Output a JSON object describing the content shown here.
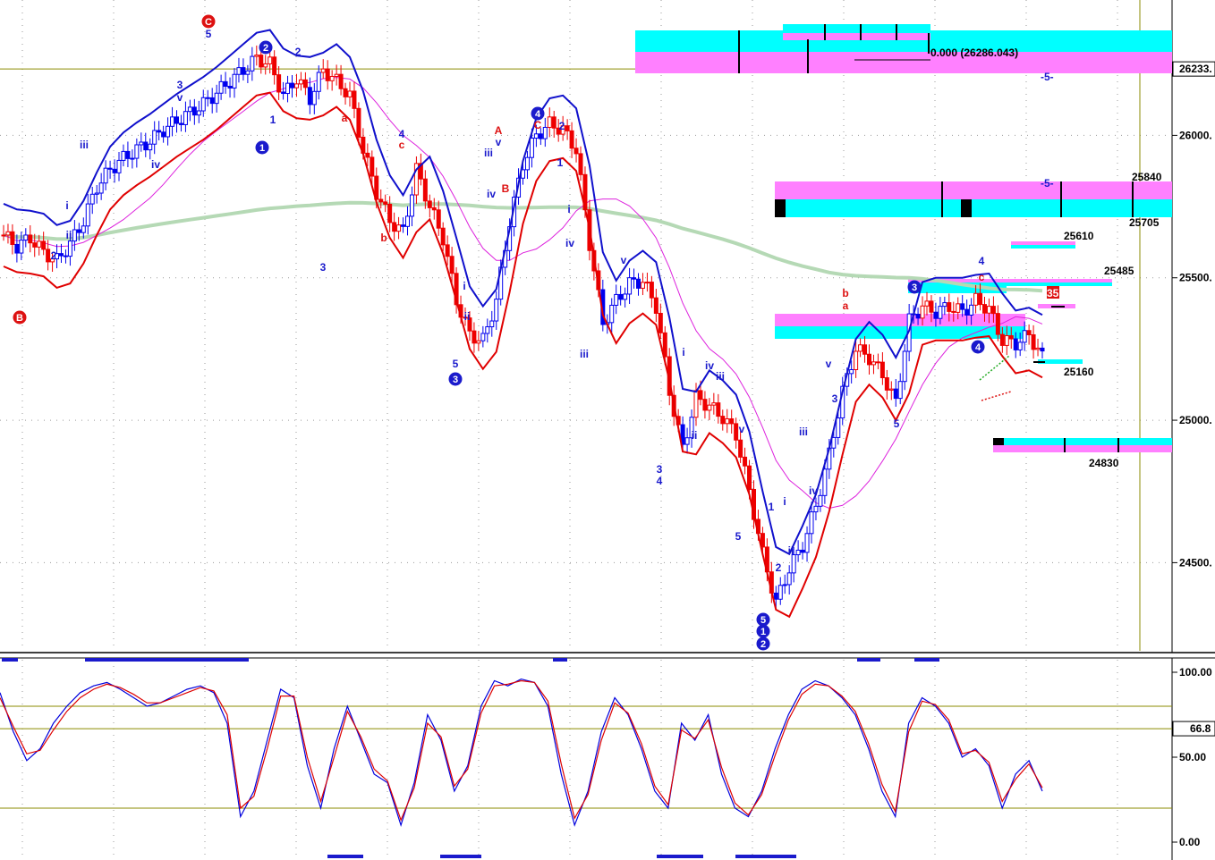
{
  "chart_data": [
    {
      "type": "candlestick",
      "panel": "price",
      "ylim": [
        24200,
        26450
      ],
      "y_ticks": [
        {
          "value": 26000,
          "label": "26000."
        },
        {
          "value": 25500,
          "label": "25500."
        },
        {
          "value": 25000,
          "label": "25000."
        },
        {
          "value": 24500,
          "label": "24500."
        }
      ],
      "current_price_label": {
        "value": 26233,
        "label": "26233."
      },
      "horizontal_reference": 26233,
      "fib_annotation": "0.000 (26286.043)",
      "target_levels": [
        {
          "value": 25840,
          "label": "25840"
        },
        {
          "value": 25705,
          "label": "25705"
        },
        {
          "value": 25610,
          "label": "25610"
        },
        {
          "value": 25485,
          "label": "25485"
        },
        {
          "value": 25160,
          "label": "25160"
        },
        {
          "value": 24830,
          "label": "24830"
        }
      ],
      "markers": [
        "-5-",
        "-5-"
      ],
      "pti_label": "35 PTI",
      "close_path": [
        25650,
        25610,
        25640,
        25590,
        25560,
        25620,
        25700,
        25820,
        25880,
        25920,
        25950,
        25980,
        26020,
        26050,
        26080,
        26110,
        26150,
        26190,
        26230,
        26270,
        26250,
        26140,
        26200,
        26130,
        26230,
        26190,
        26140,
        25950,
        25800,
        25700,
        25660,
        25880,
        25750,
        25640,
        25420,
        25300,
        25280,
        25420,
        25700,
        25900,
        26000,
        26040,
        26020,
        25950,
        25620,
        25340,
        25420,
        25480,
        25490,
        25400,
        25100,
        24900,
        25080,
        25050,
        25010,
        24950,
        24750,
        24530,
        24360,
        24480,
        24560,
        24700,
        24880,
        25100,
        25250,
        25220,
        25160,
        25060,
        25350,
        25400,
        25380,
        25400,
        25380,
        25420,
        25390,
        25280,
        25270,
        25300,
        25220
      ],
      "wave_labels": [
        {
          "text": "C",
          "style": "circle-red"
        },
        {
          "text": "B",
          "style": "circle-red"
        },
        {
          "text": "5",
          "style": "blue"
        },
        {
          "text": "2",
          "style": "circle-blue"
        },
        {
          "text": "2",
          "style": "blue"
        },
        {
          "text": "3",
          "style": "blue"
        },
        {
          "text": "v",
          "style": "blue"
        },
        {
          "text": "iii",
          "style": "blue"
        },
        {
          "text": "iv",
          "style": "blue"
        },
        {
          "text": "i",
          "style": "blue"
        },
        {
          "text": "ii",
          "style": "blue"
        },
        {
          "text": "1",
          "style": "blue"
        },
        {
          "text": "1",
          "style": "circle-blue"
        },
        {
          "text": "2",
          "style": "blue"
        },
        {
          "text": "3",
          "style": "blue"
        },
        {
          "text": "a",
          "style": "red"
        },
        {
          "text": "4",
          "style": "blue"
        },
        {
          "text": "c",
          "style": "red"
        },
        {
          "text": "b",
          "style": "red"
        },
        {
          "text": "5",
          "style": "blue"
        },
        {
          "text": "3",
          "style": "circle-blue"
        },
        {
          "text": "i",
          "style": "blue"
        },
        {
          "text": "ii",
          "style": "blue"
        },
        {
          "text": "A",
          "style": "red"
        },
        {
          "text": "v",
          "style": "blue"
        },
        {
          "text": "iii",
          "style": "blue"
        },
        {
          "text": "iv",
          "style": "blue"
        },
        {
          "text": "B",
          "style": "red"
        },
        {
          "text": "C",
          "style": "red"
        },
        {
          "text": "4",
          "style": "circle-blue"
        },
        {
          "text": "2",
          "style": "blue"
        },
        {
          "text": "1",
          "style": "blue"
        },
        {
          "text": "i",
          "style": "blue"
        },
        {
          "text": "iii",
          "style": "blue"
        },
        {
          "text": "iv",
          "style": "blue"
        },
        {
          "text": "v",
          "style": "blue"
        },
        {
          "text": "3",
          "style": "blue"
        },
        {
          "text": "4",
          "style": "blue"
        },
        {
          "text": "i",
          "style": "blue"
        },
        {
          "text": "ii",
          "style": "blue"
        },
        {
          "text": "iv",
          "style": "blue"
        },
        {
          "text": "iii",
          "style": "blue"
        },
        {
          "text": "v",
          "style": "blue"
        },
        {
          "text": "5",
          "style": "blue"
        },
        {
          "text": "5",
          "style": "circle-blue"
        },
        {
          "text": "1",
          "style": "circle-blue"
        },
        {
          "text": "2",
          "style": "circle-blue"
        },
        {
          "text": "1",
          "style": "blue"
        },
        {
          "text": "2",
          "style": "blue"
        },
        {
          "text": "i",
          "style": "blue"
        },
        {
          "text": "ii",
          "style": "blue"
        },
        {
          "text": "iii",
          "style": "blue"
        },
        {
          "text": "iv",
          "style": "blue"
        },
        {
          "text": "v",
          "style": "blue"
        },
        {
          "text": "3",
          "style": "blue"
        },
        {
          "text": "a",
          "style": "red"
        },
        {
          "text": "b",
          "style": "red"
        },
        {
          "text": "5",
          "style": "blue"
        },
        {
          "text": "3",
          "style": "circle-blue"
        },
        {
          "text": "c",
          "style": "red"
        },
        {
          "text": "4",
          "style": "blue"
        },
        {
          "text": "4",
          "style": "circle-blue"
        }
      ]
    },
    {
      "type": "line",
      "panel": "stochastic",
      "ylim": [
        0,
        100
      ],
      "y_ticks": [
        {
          "value": 100,
          "label": "100.00"
        },
        {
          "value": 50,
          "label": "50.00"
        },
        {
          "value": 0,
          "label": "0.00"
        }
      ],
      "reference_lines": [
        80,
        66.8,
        20
      ],
      "current_value_label": "66.8",
      "series": [
        {
          "color": "#0000dd",
          "values": [
            88,
            65,
            48,
            55,
            70,
            80,
            88,
            92,
            94,
            90,
            85,
            80,
            82,
            86,
            90,
            92,
            88,
            70,
            15,
            30,
            60,
            90,
            85,
            45,
            20,
            55,
            80,
            60,
            40,
            35,
            10,
            35,
            75,
            60,
            30,
            45,
            80,
            95,
            92,
            96,
            94,
            80,
            40,
            10,
            30,
            65,
            85,
            75,
            55,
            30,
            20,
            70,
            60,
            75,
            40,
            20,
            15,
            30,
            55,
            75,
            90,
            95,
            92,
            85,
            75,
            55,
            30,
            15,
            70,
            85,
            80,
            70,
            50,
            55,
            45,
            20,
            40,
            48,
            30
          ]
        },
        {
          "color": "#dd0000",
          "values": [
            85,
            68,
            52,
            54,
            66,
            77,
            85,
            90,
            93,
            91,
            87,
            82,
            82,
            85,
            88,
            91,
            89,
            75,
            20,
            27,
            55,
            86,
            86,
            50,
            24,
            50,
            77,
            62,
            43,
            36,
            13,
            32,
            70,
            62,
            33,
            43,
            76,
            92,
            93,
            95,
            94,
            83,
            46,
            14,
            28,
            60,
            82,
            76,
            58,
            33,
            22,
            66,
            61,
            72,
            44,
            23,
            16,
            28,
            51,
            72,
            87,
            93,
            92,
            86,
            77,
            58,
            34,
            18,
            65,
            83,
            81,
            72,
            52,
            54,
            47,
            24,
            37,
            46,
            32
          ]
        }
      ]
    }
  ],
  "colors": {
    "up_candle": "#0000ee",
    "down_candle": "#ee0000",
    "upper_band": "#1010cc",
    "lower_band": "#e00000",
    "ma_short": "#dd22dd",
    "ma_long": "#b5d9b5",
    "cyan_zone": "#00ffff",
    "magenta_zone": "#ff80ff",
    "grid": "#9a9a9a",
    "ref_line": "#8b8b00"
  }
}
